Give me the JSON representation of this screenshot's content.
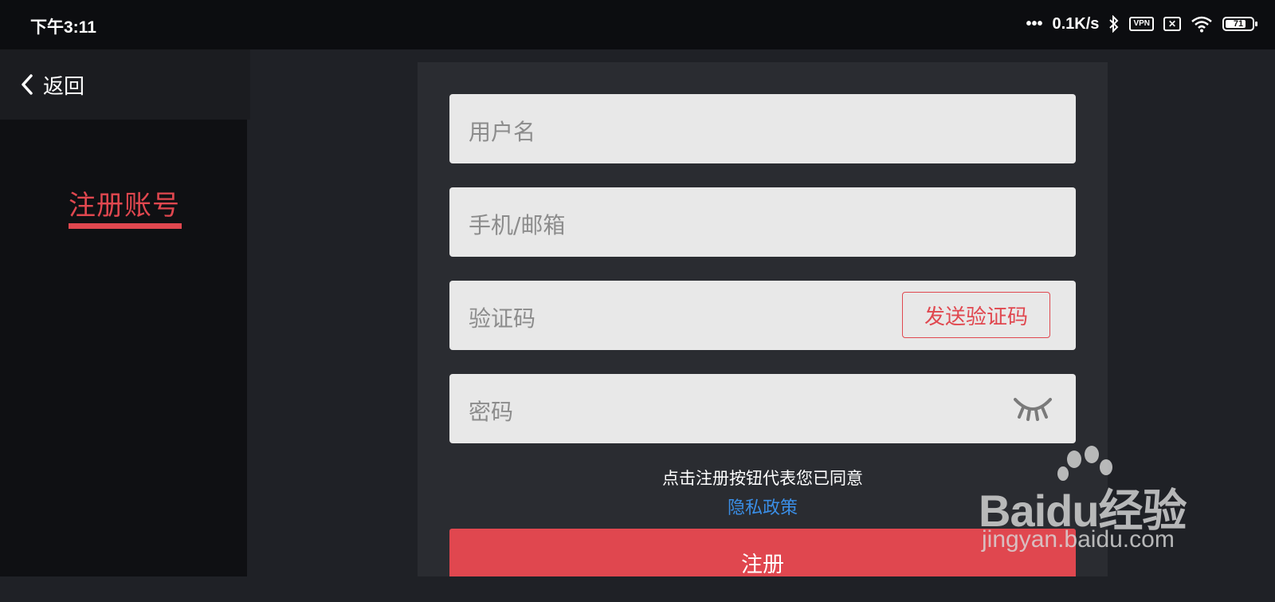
{
  "status_bar": {
    "time": "下午3:11",
    "speed": "0.1K/s",
    "vpn_label": "VPN",
    "battery": "71"
  },
  "nav": {
    "back_label": "返回",
    "tab_label": "注册账号"
  },
  "form": {
    "username_placeholder": "用户名",
    "phone_email_placeholder": "手机/邮箱",
    "code_placeholder": "验证码",
    "send_code_label": "发送验证码",
    "password_placeholder": "密码",
    "agreement_text": "点击注册按钮代表您已同意",
    "privacy_link": "隐私政策",
    "register_label": "注册"
  },
  "watermark": {
    "brand_text": "Baidu经验",
    "site_text": "jingyan.baidu.com"
  },
  "colors": {
    "accent": "#e0474f",
    "link": "#3a8ee6",
    "field_bg": "#e8e8e8",
    "panel_bg": "#2a2c31",
    "sidebar_bg": "#0f1013"
  }
}
